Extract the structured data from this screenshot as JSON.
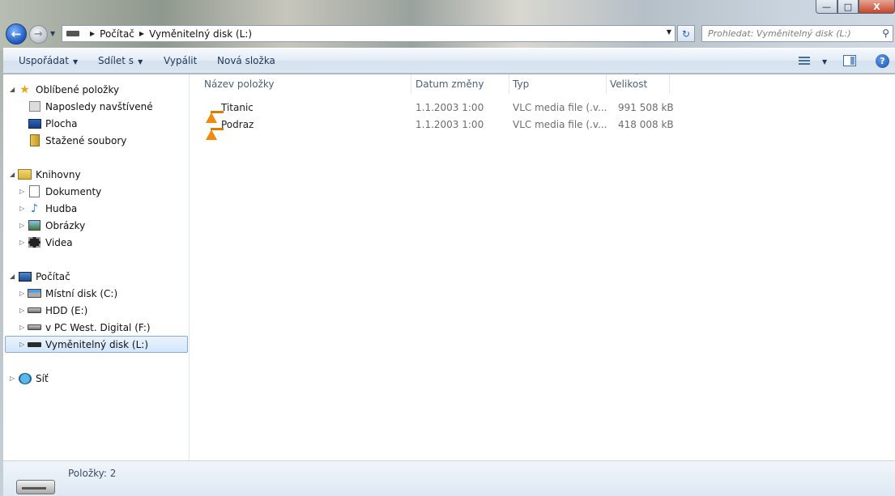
{
  "window": {
    "minimize_glyph": "—",
    "maximize_glyph": "□",
    "close_glyph": "X"
  },
  "nav": {
    "back_glyph": "←",
    "forward_glyph": "→",
    "history_glyph": "▼",
    "breadcrumbs": [
      "Počítač",
      "Vyměnitelný disk (L:)"
    ],
    "crumb_separator": "▶",
    "address_dropdown_glyph": "▼",
    "refresh_glyph": "↻",
    "search_placeholder": "Prohledat: Vyměnitelný disk (L:)",
    "search_icon_glyph": "⚲"
  },
  "toolbar": {
    "organize_label": "Uspořádat",
    "share_label": "Sdílet s",
    "burn_label": "Vypálit",
    "new_folder_label": "Nová složka",
    "dropdown_glyph": "▼",
    "help_glyph": "?"
  },
  "tree": {
    "favorites": {
      "label": "Oblíbené položky",
      "items": [
        "Naposledy navštívené",
        "Plocha",
        "Stažené soubory"
      ]
    },
    "libraries": {
      "label": "Knihovny",
      "items": [
        "Dokumenty",
        "Hudba",
        "Obrázky",
        "Videa"
      ]
    },
    "computer": {
      "label": "Počítač",
      "items": [
        "Místní disk (C:)",
        "HDD (E:)",
        "v PC West. Digital (F:)",
        "Vyměnitelný disk (L:)"
      ]
    },
    "network": {
      "label": "Síť"
    },
    "expanded_glyph": "◢",
    "collapsed_glyph": "▷",
    "star_glyph": "★",
    "note_glyph": "♪"
  },
  "list": {
    "columns": [
      "Název položky",
      "Datum změny",
      "Typ",
      "Velikost"
    ],
    "sort_glyph": "⌃",
    "rows": [
      {
        "name": "Titanic",
        "date": "1.1.2003 1:00",
        "type": "VLC media file (.v...",
        "size": "991 508 kB"
      },
      {
        "name": "Podraz",
        "date": "1.1.2003 1:00",
        "type": "VLC media file (.v...",
        "size": "418 008 kB"
      }
    ]
  },
  "status": {
    "items_count": "Položky: 2"
  },
  "colors": {
    "accent": "#1e395b",
    "selection_border": "#84acdd",
    "vlc_orange": "#f08a10"
  }
}
